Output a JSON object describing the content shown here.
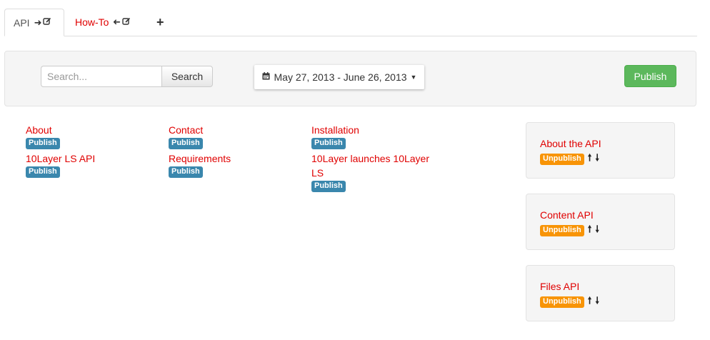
{
  "tabs": [
    {
      "label": "API",
      "icons": [
        "arrow-right-icon",
        "edit-icon"
      ]
    },
    {
      "label": "How-To",
      "icons": [
        "arrow-left-icon",
        "edit-icon"
      ]
    },
    {
      "label": "+",
      "icons": [
        "plus-icon"
      ]
    }
  ],
  "toolbar": {
    "search_placeholder": "Search...",
    "search_button": "Search",
    "date_range": "May 27, 2013 - June 26, 2013",
    "publish_button": "Publish"
  },
  "columns": [
    {
      "pages": [
        {
          "title": "About",
          "action": "Publish"
        },
        {
          "title": "10Layer LS API",
          "action": "Publish"
        }
      ]
    },
    {
      "pages": [
        {
          "title": "Contact",
          "action": "Publish"
        },
        {
          "title": "Requirements",
          "action": "Publish"
        }
      ]
    },
    {
      "pages": [
        {
          "title": "Installation",
          "action": "Publish"
        },
        {
          "title": "10Layer launches 10Layer LS",
          "action": "Publish"
        }
      ]
    }
  ],
  "published": [
    {
      "title": "About the API",
      "action": "Unpublish"
    },
    {
      "title": "Content API",
      "action": "Unpublish"
    },
    {
      "title": "Files API",
      "action": "Unpublish"
    }
  ],
  "colors": {
    "link": "#e00000",
    "publish_green": "#5cb85c",
    "label_info": "#3a87ad",
    "label_warning": "#f89406"
  }
}
